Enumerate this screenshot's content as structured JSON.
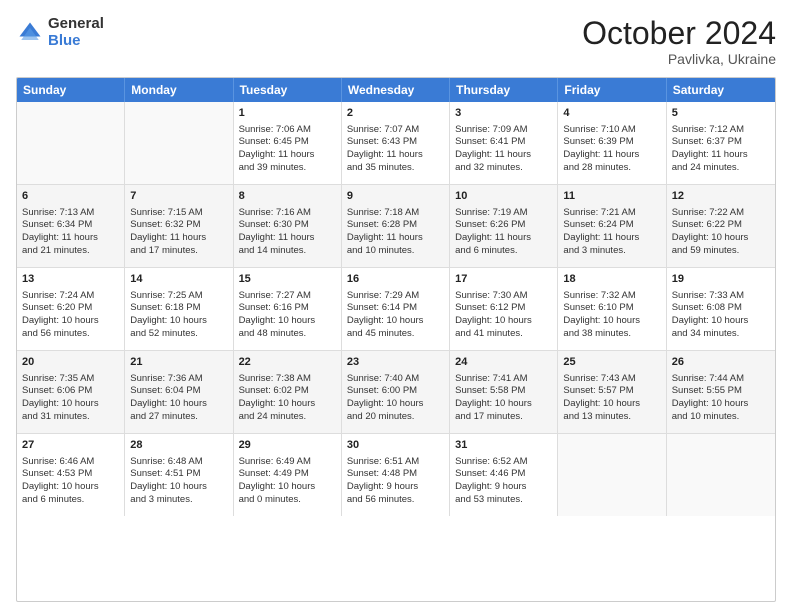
{
  "logo": {
    "general": "General",
    "blue": "Blue"
  },
  "header": {
    "month": "October 2024",
    "location": "Pavlivka, Ukraine"
  },
  "days": [
    "Sunday",
    "Monday",
    "Tuesday",
    "Wednesday",
    "Thursday",
    "Friday",
    "Saturday"
  ],
  "rows": [
    [
      {
        "day": "",
        "lines": []
      },
      {
        "day": "",
        "lines": []
      },
      {
        "day": "1",
        "lines": [
          "Sunrise: 7:06 AM",
          "Sunset: 6:45 PM",
          "Daylight: 11 hours",
          "and 39 minutes."
        ]
      },
      {
        "day": "2",
        "lines": [
          "Sunrise: 7:07 AM",
          "Sunset: 6:43 PM",
          "Daylight: 11 hours",
          "and 35 minutes."
        ]
      },
      {
        "day": "3",
        "lines": [
          "Sunrise: 7:09 AM",
          "Sunset: 6:41 PM",
          "Daylight: 11 hours",
          "and 32 minutes."
        ]
      },
      {
        "day": "4",
        "lines": [
          "Sunrise: 7:10 AM",
          "Sunset: 6:39 PM",
          "Daylight: 11 hours",
          "and 28 minutes."
        ]
      },
      {
        "day": "5",
        "lines": [
          "Sunrise: 7:12 AM",
          "Sunset: 6:37 PM",
          "Daylight: 11 hours",
          "and 24 minutes."
        ]
      }
    ],
    [
      {
        "day": "6",
        "lines": [
          "Sunrise: 7:13 AM",
          "Sunset: 6:34 PM",
          "Daylight: 11 hours",
          "and 21 minutes."
        ]
      },
      {
        "day": "7",
        "lines": [
          "Sunrise: 7:15 AM",
          "Sunset: 6:32 PM",
          "Daylight: 11 hours",
          "and 17 minutes."
        ]
      },
      {
        "day": "8",
        "lines": [
          "Sunrise: 7:16 AM",
          "Sunset: 6:30 PM",
          "Daylight: 11 hours",
          "and 14 minutes."
        ]
      },
      {
        "day": "9",
        "lines": [
          "Sunrise: 7:18 AM",
          "Sunset: 6:28 PM",
          "Daylight: 11 hours",
          "and 10 minutes."
        ]
      },
      {
        "day": "10",
        "lines": [
          "Sunrise: 7:19 AM",
          "Sunset: 6:26 PM",
          "Daylight: 11 hours",
          "and 6 minutes."
        ]
      },
      {
        "day": "11",
        "lines": [
          "Sunrise: 7:21 AM",
          "Sunset: 6:24 PM",
          "Daylight: 11 hours",
          "and 3 minutes."
        ]
      },
      {
        "day": "12",
        "lines": [
          "Sunrise: 7:22 AM",
          "Sunset: 6:22 PM",
          "Daylight: 10 hours",
          "and 59 minutes."
        ]
      }
    ],
    [
      {
        "day": "13",
        "lines": [
          "Sunrise: 7:24 AM",
          "Sunset: 6:20 PM",
          "Daylight: 10 hours",
          "and 56 minutes."
        ]
      },
      {
        "day": "14",
        "lines": [
          "Sunrise: 7:25 AM",
          "Sunset: 6:18 PM",
          "Daylight: 10 hours",
          "and 52 minutes."
        ]
      },
      {
        "day": "15",
        "lines": [
          "Sunrise: 7:27 AM",
          "Sunset: 6:16 PM",
          "Daylight: 10 hours",
          "and 48 minutes."
        ]
      },
      {
        "day": "16",
        "lines": [
          "Sunrise: 7:29 AM",
          "Sunset: 6:14 PM",
          "Daylight: 10 hours",
          "and 45 minutes."
        ]
      },
      {
        "day": "17",
        "lines": [
          "Sunrise: 7:30 AM",
          "Sunset: 6:12 PM",
          "Daylight: 10 hours",
          "and 41 minutes."
        ]
      },
      {
        "day": "18",
        "lines": [
          "Sunrise: 7:32 AM",
          "Sunset: 6:10 PM",
          "Daylight: 10 hours",
          "and 38 minutes."
        ]
      },
      {
        "day": "19",
        "lines": [
          "Sunrise: 7:33 AM",
          "Sunset: 6:08 PM",
          "Daylight: 10 hours",
          "and 34 minutes."
        ]
      }
    ],
    [
      {
        "day": "20",
        "lines": [
          "Sunrise: 7:35 AM",
          "Sunset: 6:06 PM",
          "Daylight: 10 hours",
          "and 31 minutes."
        ]
      },
      {
        "day": "21",
        "lines": [
          "Sunrise: 7:36 AM",
          "Sunset: 6:04 PM",
          "Daylight: 10 hours",
          "and 27 minutes."
        ]
      },
      {
        "day": "22",
        "lines": [
          "Sunrise: 7:38 AM",
          "Sunset: 6:02 PM",
          "Daylight: 10 hours",
          "and 24 minutes."
        ]
      },
      {
        "day": "23",
        "lines": [
          "Sunrise: 7:40 AM",
          "Sunset: 6:00 PM",
          "Daylight: 10 hours",
          "and 20 minutes."
        ]
      },
      {
        "day": "24",
        "lines": [
          "Sunrise: 7:41 AM",
          "Sunset: 5:58 PM",
          "Daylight: 10 hours",
          "and 17 minutes."
        ]
      },
      {
        "day": "25",
        "lines": [
          "Sunrise: 7:43 AM",
          "Sunset: 5:57 PM",
          "Daylight: 10 hours",
          "and 13 minutes."
        ]
      },
      {
        "day": "26",
        "lines": [
          "Sunrise: 7:44 AM",
          "Sunset: 5:55 PM",
          "Daylight: 10 hours",
          "and 10 minutes."
        ]
      }
    ],
    [
      {
        "day": "27",
        "lines": [
          "Sunrise: 6:46 AM",
          "Sunset: 4:53 PM",
          "Daylight: 10 hours",
          "and 6 minutes."
        ]
      },
      {
        "day": "28",
        "lines": [
          "Sunrise: 6:48 AM",
          "Sunset: 4:51 PM",
          "Daylight: 10 hours",
          "and 3 minutes."
        ]
      },
      {
        "day": "29",
        "lines": [
          "Sunrise: 6:49 AM",
          "Sunset: 4:49 PM",
          "Daylight: 10 hours",
          "and 0 minutes."
        ]
      },
      {
        "day": "30",
        "lines": [
          "Sunrise: 6:51 AM",
          "Sunset: 4:48 PM",
          "Daylight: 9 hours",
          "and 56 minutes."
        ]
      },
      {
        "day": "31",
        "lines": [
          "Sunrise: 6:52 AM",
          "Sunset: 4:46 PM",
          "Daylight: 9 hours",
          "and 53 minutes."
        ]
      },
      {
        "day": "",
        "lines": []
      },
      {
        "day": "",
        "lines": []
      }
    ]
  ]
}
